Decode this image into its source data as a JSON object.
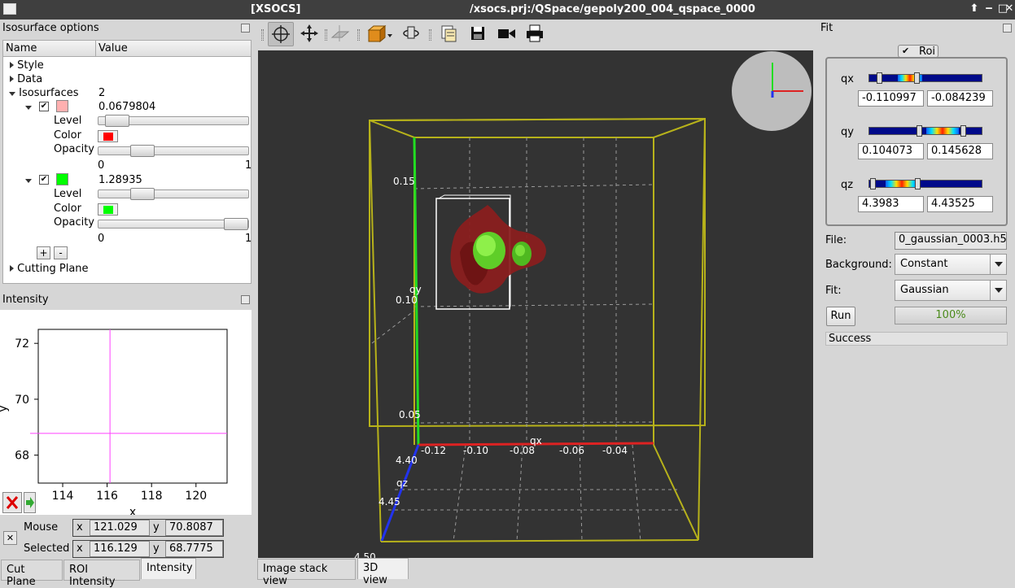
{
  "window": {
    "app_title": "[XSOCS]",
    "doc_title": "/xsocs.prj:/QSpace/gepoly200_004_qspace_0000"
  },
  "iso_panel": {
    "title": "Isosurface options",
    "col_name": "Name",
    "col_value": "Value",
    "style": "Style",
    "data": "Data",
    "isosurfaces": "Isosurfaces",
    "iso_count": "2",
    "iso1": {
      "value": "0.0679804",
      "color": "#ffb0b0",
      "swatch_color": "#ff0000",
      "level": 0.05,
      "opacity": 0.25,
      "level_label": "Level",
      "color_label": "Color",
      "opacity_label": "Opacity",
      "min": "0",
      "max": "1"
    },
    "iso2": {
      "value": "1.28935",
      "color": "#00ff00",
      "swatch_color": "#00ff00",
      "level": 0.25,
      "opacity": 1.0,
      "level_label": "Level",
      "color_label": "Color",
      "opacity_label": "Opacity",
      "min": "0",
      "max": "1"
    },
    "add": "+",
    "remove": "-",
    "cutting_plane": "Cutting Plane"
  },
  "intensity_panel": {
    "title": "Intensity",
    "xlabel": "x",
    "mouse_label": "Mouse",
    "selected_label": "Selected",
    "x_label": "x",
    "y_label": "y",
    "mouse_x": "121.029",
    "mouse_y": "70.8087",
    "selected_x": "116.129",
    "selected_y": "68.7775"
  },
  "chart_data": {
    "type": "heatmap",
    "xlabel": "x",
    "ylabel": "y",
    "x_ticks": [
      "114",
      "116",
      "118",
      "120"
    ],
    "y_ticks": [
      "68",
      "70",
      "72"
    ],
    "xlim": [
      112.9,
      121.4
    ],
    "ylim": [
      67.0,
      72.5
    ],
    "crosshair": {
      "x": 116.129,
      "y": 68.7775
    }
  },
  "left_tabs": [
    "Cut Plane",
    "ROI Intensity",
    "Intensity"
  ],
  "toolbar": {
    "icons": [
      "rotate-icon",
      "pan-icon",
      "plane-icon",
      "cube-view-icon",
      "reset-zoom-icon",
      "copy-icon",
      "save-icon",
      "video-icon",
      "print-icon"
    ]
  },
  "view3d": {
    "axis_qx": "qx",
    "axis_qy": "qy",
    "axis_qz": "qz",
    "qx_ticks": [
      "-0.12",
      "-0.10",
      "-0.08",
      "-0.06",
      "-0.04"
    ],
    "qy_ticks": [
      "0.15",
      "0.10",
      "0.05"
    ],
    "qz_ticks": [
      "4.40",
      "4.45",
      "4.50"
    ]
  },
  "center_tabs": [
    "Image stack view",
    "3D view"
  ],
  "fit": {
    "title": "Fit",
    "roi_label": "Roi",
    "qx_label": "qx",
    "qy_label": "qy",
    "qz_label": "qz",
    "qx_min": "-0.110997",
    "qx_max": "-0.084239",
    "qy_min": "0.104073",
    "qy_max": "0.145628",
    "qz_min": "4.3983",
    "qz_max": "4.43525",
    "file_label": "File:",
    "file_value": "0_gaussian_0003.h5",
    "background_label": "Background:",
    "background_value": "Constant",
    "fit_label": "Fit:",
    "fit_value": "Gaussian",
    "run_label": "Run",
    "progress_text": "100%",
    "progress": 1.0,
    "status": "Success"
  }
}
